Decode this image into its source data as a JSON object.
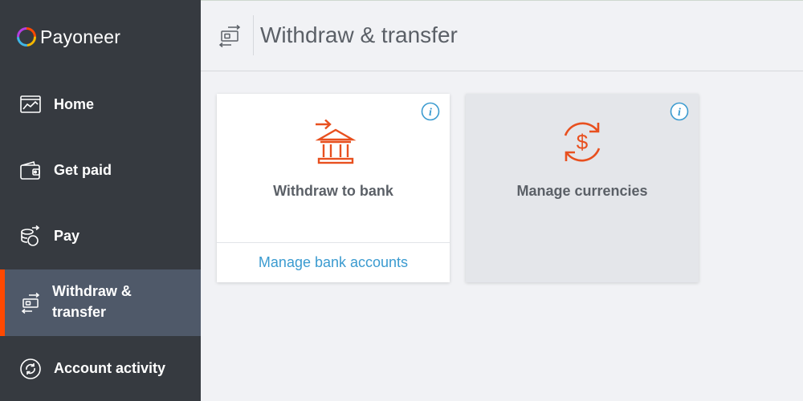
{
  "brand": {
    "name": "Payoneer"
  },
  "sidebar": {
    "items": [
      {
        "label": "Home",
        "icon": "home-dashboard-icon"
      },
      {
        "label": "Get paid",
        "icon": "wallet-icon"
      },
      {
        "label": "Pay",
        "icon": "pay-coins-icon"
      },
      {
        "label": "Withdraw & transfer",
        "icon": "transfer-icon",
        "active": true
      },
      {
        "label": "Account activity",
        "icon": "activity-refresh-icon"
      }
    ]
  },
  "header": {
    "title": "Withdraw & transfer",
    "icon": "transfer-icon"
  },
  "cards": [
    {
      "title": "Withdraw to bank",
      "icon": "bank-withdraw-icon",
      "link": "Manage bank accounts"
    },
    {
      "title": "Manage currencies",
      "icon": "currency-exchange-icon"
    }
  ],
  "colors": {
    "accent": "#ff4800",
    "sidebar_bg": "#363a40",
    "active_bg": "#4f5969",
    "link": "#3b9bd0",
    "icon_orange": "#e8501f"
  }
}
